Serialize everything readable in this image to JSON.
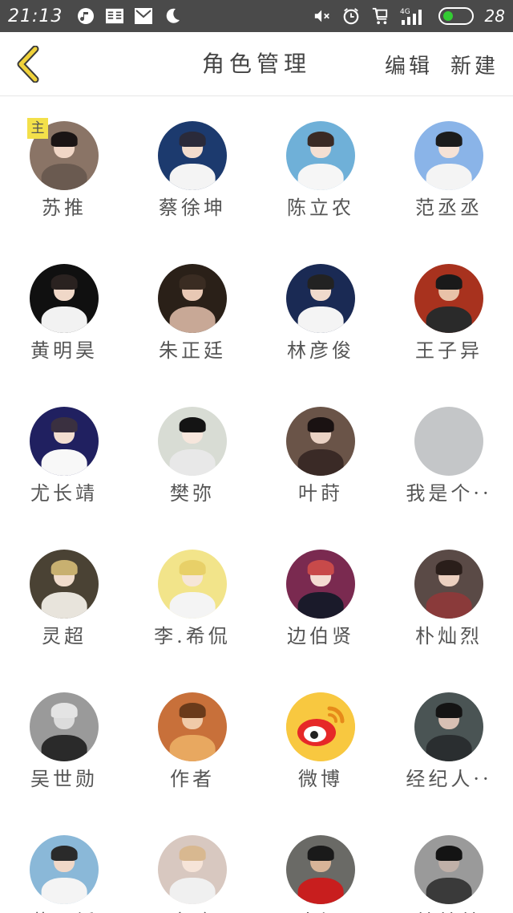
{
  "status_bar": {
    "time": "21:13",
    "battery_level": "28",
    "network": "4G",
    "icons": [
      "music-icon",
      "reader-icon",
      "mail-icon",
      "moon-icon",
      "mute-icon",
      "alarm-icon",
      "cart-icon",
      "signal-icon",
      "battery-icon"
    ],
    "battery_color": "#33cc33"
  },
  "header": {
    "title": "角色管理",
    "edit_label": "编辑",
    "new_label": "新建",
    "back_icon": "chevron-left-icon",
    "accent_color": "#f0d23a"
  },
  "roles": [
    {
      "name": "苏推",
      "badge": "主",
      "avatar": {
        "bg": "#8a7466",
        "hair": "#1a1414",
        "skin": "#f0d6c6",
        "body": "#6a5a50"
      }
    },
    {
      "name": "蔡徐坤",
      "avatar": {
        "bg": "#1c3a6e",
        "hair": "#2a2a3a",
        "skin": "#f2dccd",
        "body": "#f4f4f4"
      }
    },
    {
      "name": "陈立农",
      "avatar": {
        "bg": "#6fb0d8",
        "hair": "#3a2a24",
        "skin": "#f4dfd2",
        "body": "#f6f6f6"
      }
    },
    {
      "name": "范丞丞",
      "avatar": {
        "bg": "#8ab4e8",
        "hair": "#1c1c1c",
        "skin": "#f6e2d6",
        "body": "#f4f4f4"
      }
    },
    {
      "name": "黄明昊",
      "avatar": {
        "bg": "#101010",
        "hair": "#2a2220",
        "skin": "#f0d8c8",
        "body": "#f2f2f2"
      }
    },
    {
      "name": "朱正廷",
      "avatar": {
        "bg": "#2a2018",
        "hair": "#3a2c22",
        "skin": "#e8c8b4",
        "body": "#c8a896"
      }
    },
    {
      "name": "林彦俊",
      "avatar": {
        "bg": "#1a2a54",
        "hair": "#222222",
        "skin": "#f0dacc",
        "body": "#f4f4f4"
      }
    },
    {
      "name": "王子异",
      "avatar": {
        "bg": "#a8321e",
        "hair": "#1a1a1a",
        "skin": "#e8c2a8",
        "body": "#2a2a2a"
      }
    },
    {
      "name": "尤长靖",
      "avatar": {
        "bg": "#202060",
        "hair": "#3a3040",
        "skin": "#f2ddd0",
        "body": "#f8f8f8"
      }
    },
    {
      "name": "樊弥",
      "avatar": {
        "bg": "#d8dcd4",
        "hair": "#141414",
        "skin": "#f6e6dc",
        "body": "#e8e8e8"
      }
    },
    {
      "name": "叶莳",
      "avatar": {
        "bg": "#6a5448",
        "hair": "#1a1212",
        "skin": "#ead2c4",
        "body": "#3a2a26"
      }
    },
    {
      "name": "我是个··",
      "avatar": {
        "bg": "#c4c6c8",
        "hair": "#c4c6c8",
        "skin": "#c4c6c8",
        "body": "#c4c6c8"
      }
    },
    {
      "name": "灵超",
      "avatar": {
        "bg": "#4a4234",
        "hair": "#c8b070",
        "skin": "#f0dccc",
        "body": "#e8e4dc"
      }
    },
    {
      "name": "李.希侃",
      "avatar": {
        "bg": "#f2e48a",
        "hair": "#e8d068",
        "skin": "#f6e6d8",
        "body": "#f4f4f4"
      }
    },
    {
      "name": "边伯贤",
      "avatar": {
        "bg": "#7a2a50",
        "hair": "#c84a4a",
        "skin": "#f4dcd2",
        "body": "#1a1a2a"
      }
    },
    {
      "name": "朴灿烈",
      "avatar": {
        "bg": "#5a4a46",
        "hair": "#2a1e1a",
        "skin": "#ecd0c0",
        "body": "#8a3a3a"
      }
    },
    {
      "name": "吴世勋",
      "avatar": {
        "bg": "#9a9a9a",
        "hair": "#e4e4e4",
        "skin": "#dcdcdc",
        "body": "#2a2a2a"
      }
    },
    {
      "name": "作者",
      "avatar": {
        "bg": "#c8703a",
        "hair": "#6a3a1a",
        "skin": "#f0caa8",
        "body": "#e8a860"
      }
    },
    {
      "name": "微博",
      "avatar": {
        "bg": "#f8c840",
        "hair": "#e62828",
        "skin": "#ffffff",
        "body": "#f8c840"
      }
    },
    {
      "name": "经纪人··",
      "avatar": {
        "bg": "#4a5454",
        "hair": "#141414",
        "skin": "#d8c0b4",
        "body": "#2a2e30"
      }
    },
    {
      "name": "黄子韬",
      "avatar": {
        "bg": "#8ab8d8",
        "hair": "#2a2a2a",
        "skin": "#f0d8c8",
        "body": "#f4f4f4"
      }
    },
    {
      "name": "鹿晗",
      "avatar": {
        "bg": "#d8c8c0",
        "hair": "#d8b890",
        "skin": "#f6e4d8",
        "body": "#f0f0f0"
      }
    },
    {
      "name": "人间",
      "avatar": {
        "bg": "#6a6a66",
        "hair": "#1a1a1a",
        "skin": "#d8b498",
        "body": "#c81e1e"
      }
    },
    {
      "name": "某某某",
      "avatar": {
        "bg": "#9a9a9a",
        "hair": "#141414",
        "skin": "#c0b0a8",
        "body": "#3a3a3a"
      }
    }
  ]
}
